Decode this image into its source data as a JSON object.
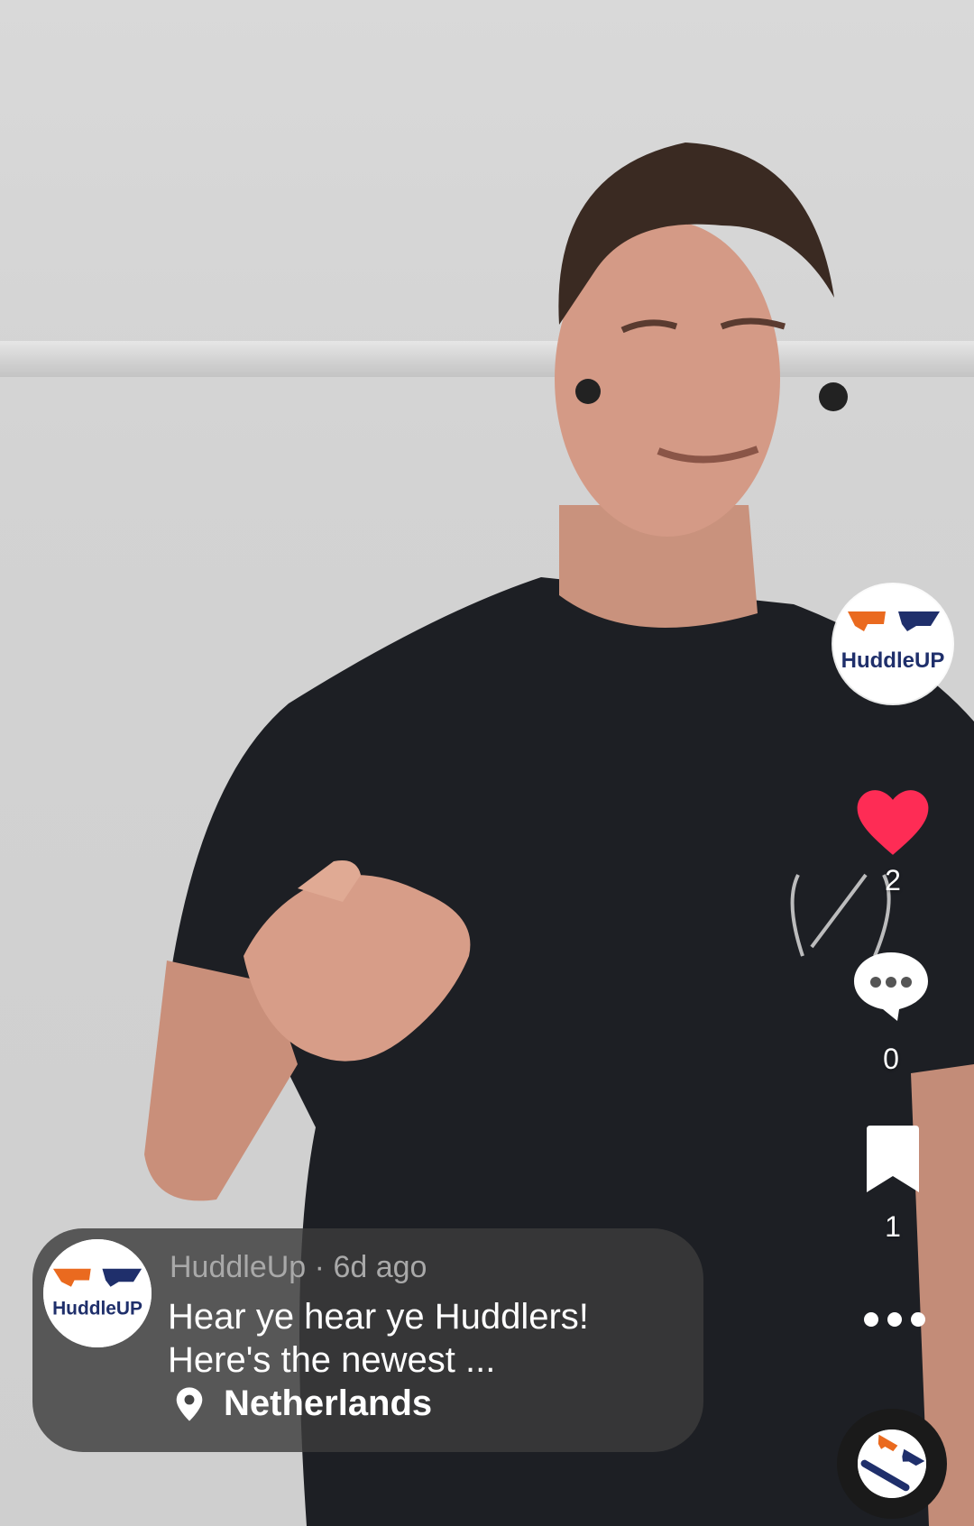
{
  "brand": {
    "name": "HuddleUP",
    "caption_logo_text": "HuddleUP",
    "orange": "#ea6a1f",
    "navy": "#1f2f6b"
  },
  "actions": {
    "likes": "2",
    "comments": "0",
    "saves": "1",
    "like_color": "#fe2c55",
    "icons": [
      "heart-icon",
      "comment-icon",
      "bookmark-icon",
      "more-icon"
    ]
  },
  "post": {
    "author": "HuddleUp",
    "age": "6d ago",
    "meta_separator": "·",
    "caption_line1": "Hear ye hear ye Huddlers!",
    "caption_line2": "Here's the newest ...",
    "location": "Netherlands"
  }
}
